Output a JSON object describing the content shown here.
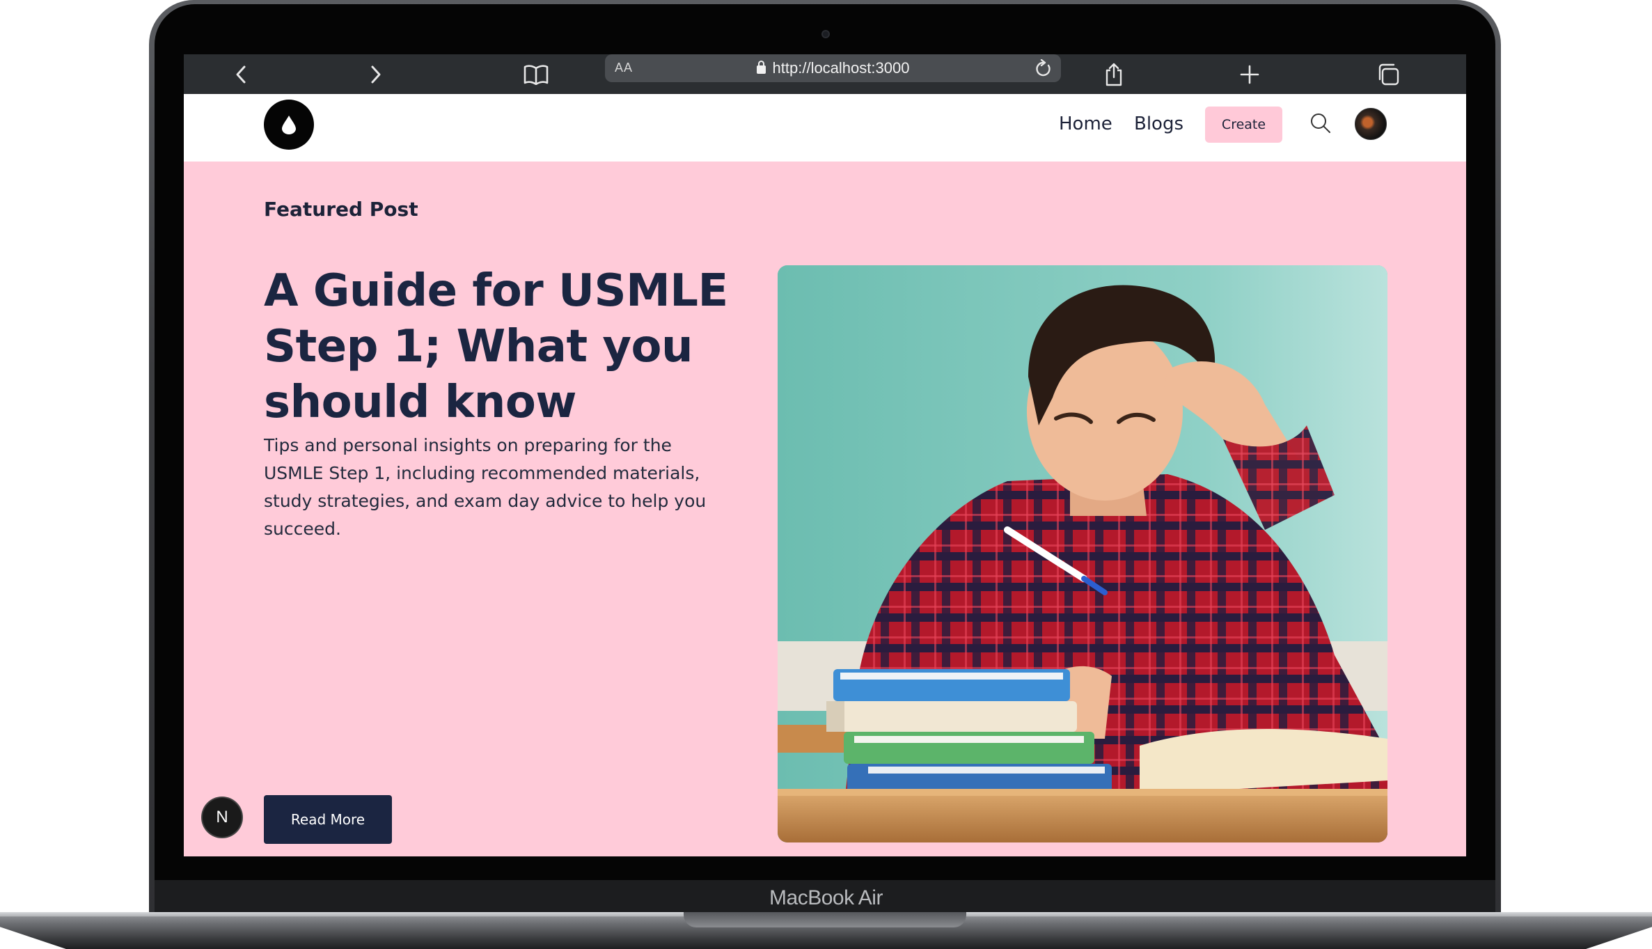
{
  "device": {
    "label": "MacBook Air"
  },
  "browser": {
    "url": "http://localhost:3000",
    "reader_label": "AA"
  },
  "nav": {
    "links": [
      {
        "label": "Home"
      },
      {
        "label": "Blogs"
      }
    ],
    "create_label": "Create"
  },
  "hero": {
    "eyebrow": "Featured Post",
    "title": "A Guide for USMLE Step 1; What you should know",
    "excerpt": "Tips and personal insights on preparing for the USMLE Step 1, including recommended materials, study strategies, and exam day advice to help you succeed.",
    "cta_label": "Read More",
    "dev_badge": "N"
  },
  "colors": {
    "hero_bg": "#ffcbd9",
    "heading": "#1b2541",
    "button": "#1b2541",
    "create_button": "#ffc9d8"
  }
}
